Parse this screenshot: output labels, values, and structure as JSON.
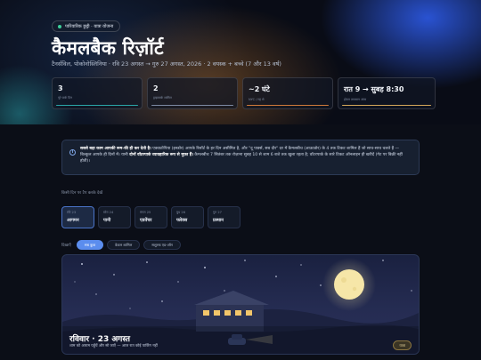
{
  "hero": {
    "badge": "पारिवारिक छुट्टी · यात्रा योजना",
    "title": "कैमलबैक रिज़ॉर्ट",
    "subtitle": "टैनर्सविल, पोकोनोस्लिनिया · रवि 23 अगस्त → गुरु 27 अगस्त, 2026 · 2 वयस्क + बच्चे (7 और 13 वर्ष)"
  },
  "stats": [
    {
      "value": "3",
      "label": "पूरे पार्क दिन"
    },
    {
      "value": "2",
      "label": "ड्राइववर्क शामिल"
    },
    {
      "value": "~2 घंटे",
      "label": "NYC / NJ से"
    },
    {
      "value": "रात 9 → सुबह 8:30",
      "label": "होटल तापमान अंतर"
    }
  ],
  "notice": {
    "bold_lead": "सबसे बड़ा काम आपकी रूम-की ही कर देती है।",
    "text": " एक्वाटोपिया (इनडोर) आपके रिसॉर्ट के हर दिन असीमित है, और \"दू पार्क्स, सब दौर\" दर में कैमलबीच (आउटडोर) के 4 तक टिकट शामिल हैं जो साथ-साथ चलते हैं — बिल्कुल आपके ही दिनों में। यानी ",
    "bold_mid": "दोनों वॉटरपार्क व्यावहारिक रूप से मुफ़्त हैं।",
    "text_end": " कैमलबीच 7 सितंबर तक रोज़ाना सुबह 10 से शाम 6 बजे तक खुला रहता है; वॉटरपार्क के सारे टिकट ऑनलाइन ही खरीदें (गेट पर बिक्री नहीं होती)।"
  },
  "day_picker": {
    "label": "किसी दिन पर टैप करके देखें",
    "days": [
      {
        "top": "रवि 23",
        "name": "आगमन"
      },
      {
        "top": "सोम 24",
        "name": "पानी"
      },
      {
        "top": "मंगल 25",
        "name": "एडवेंचर"
      },
      {
        "top": "बुध 26",
        "name": "फ्लेक्स"
      },
      {
        "top": "गुरु 27",
        "name": "प्रस्थान"
      }
    ]
  },
  "filters": {
    "label": "दिखाएँ",
    "chips": [
      "सब कुछ",
      "केवल शामिल",
      "सशुल्क एड-ऑन"
    ]
  },
  "card": {
    "title": "रविवार · 23 अगस्त",
    "subtitle": "शाम को आराम पहुँचें और सो जाएँ — आज रात कोई पार्किंग नहीं",
    "tag": "यात्रा"
  },
  "colors": {
    "accent": "#5b8dee",
    "background": "#0b0e17",
    "moon": "#f6e6a8"
  }
}
